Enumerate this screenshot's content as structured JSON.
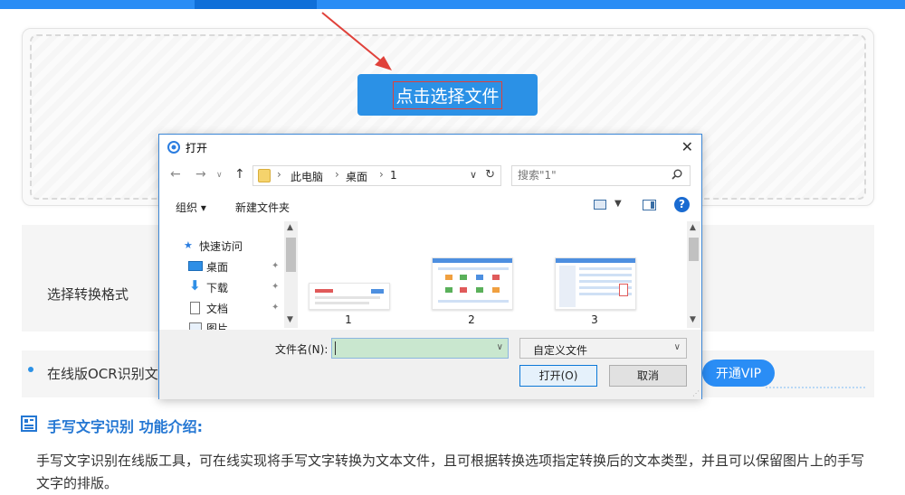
{
  "page": {
    "choose_button": "点击选择文件",
    "format_label": "选择转换格式",
    "ocr_text": "在线版OCR识别文",
    "vip_button": "开通VIP",
    "feature_title": "手写文字识别 功能介绍:",
    "feature_desc": "手写文字识别在线版工具，可在线实现将手写文字转换为文本文件，且可根据转换选项指定转换后的文本类型，并且可以保留图片上的手写文字的排版。"
  },
  "dialog": {
    "title": "打开",
    "address": {
      "segments": [
        "此电脑",
        "桌面",
        "1"
      ]
    },
    "search_placeholder": "搜索\"1\"",
    "toolbar": {
      "organize": "组织 ▾",
      "new_folder": "新建文件夹",
      "help": "?"
    },
    "tree": [
      {
        "label": "快速访问",
        "pinned": false
      },
      {
        "label": "桌面",
        "pinned": true
      },
      {
        "label": "下载",
        "pinned": true
      },
      {
        "label": "文档",
        "pinned": true
      },
      {
        "label": "图片",
        "pinned": false
      }
    ],
    "files": [
      "1",
      "2",
      "3"
    ],
    "filename_label": "文件名(N):",
    "filename_value": "",
    "file_type": "自定义文件",
    "open_button": "打开(O)",
    "cancel_button": "取消"
  },
  "colors": {
    "brand_blue": "#2b91e6",
    "annotation_red": "#e0413a",
    "filename_highlight": "#c9e7cf"
  }
}
